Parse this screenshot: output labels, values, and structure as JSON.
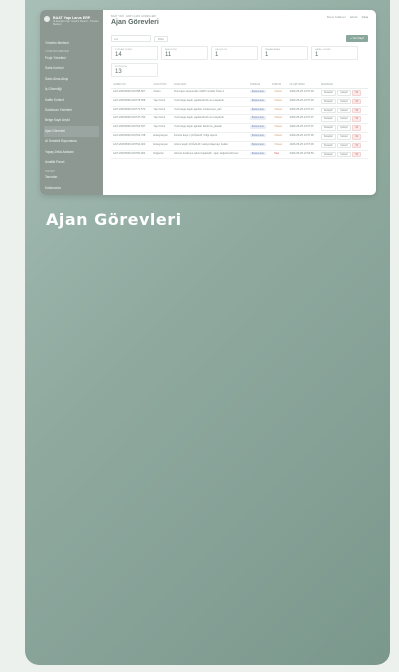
{
  "sidebar": {
    "brand_title": "BAAT Yapı Larus ERP",
    "brand_subtitle": "AI Destekli Yapı Yönetim Sistemi · Yönetim Merkezi",
    "items": [
      {
        "label": "Yönetim Merkezi",
        "type": "item"
      },
      {
        "label": "Yönetim Merkezi",
        "type": "section"
      },
      {
        "label": "Proje Yönetimi",
        "type": "item"
      },
      {
        "label": "Saha Kontrol",
        "type": "item"
      },
      {
        "label": "Satın Alma Akışı",
        "type": "item"
      },
      {
        "label": "İş Güvenliği",
        "type": "item"
      },
      {
        "label": "Kalite Kontrol",
        "type": "item"
      },
      {
        "label": "Doküman Yönetimi",
        "type": "item"
      },
      {
        "label": "Belge Kayıt Arşivi",
        "type": "item"
      },
      {
        "label": "Ajan Görevleri",
        "type": "item",
        "active": true
      },
      {
        "label": "AI Destekli Raporlama",
        "type": "item"
      },
      {
        "label": "Yapay Zekâ Asistanı",
        "type": "item"
      },
      {
        "label": "Analitik Panel",
        "type": "item"
      },
      {
        "label": "Sistem",
        "type": "section"
      },
      {
        "label": "Tanımlar",
        "type": "item"
      },
      {
        "label": "Kullanıcılar",
        "type": "item"
      },
      {
        "label": "Entegrasyonlar",
        "type": "item"
      },
      {
        "label": "Yardım",
        "type": "section"
      },
      {
        "label": "Hakkında",
        "type": "item"
      }
    ]
  },
  "header": {
    "breadcrumb": "BAAT YAPI · ERP / AJAN GÖREVLERİ",
    "title": "Ajan Görevleri",
    "user": "Demo Kullanıcı",
    "user_role": "Admin",
    "logout": "Çıkış"
  },
  "toolbar": {
    "filter_placeholder": "Ara",
    "filter_button": "Filtre",
    "new_button": "+ Yeni Kayıt"
  },
  "stats": [
    {
      "label": "TOPLAM GÖREV",
      "value": "14"
    },
    {
      "label": "BEKLEYEN",
      "value": "11"
    },
    {
      "label": "ÇALIŞIYOR",
      "value": "1"
    },
    {
      "label": "TAMAMLANAN",
      "value": "1"
    },
    {
      "label": "HATALI GÖREV",
      "value": "1"
    },
    {
      "label": "KUYRUKTA",
      "value": "13"
    }
  ],
  "table": {
    "columns": [
      "GÖREV NO",
      "AJAN TÜRÜ",
      "AÇIKLAMA",
      "ÖNCELİK",
      "DURUM",
      "OLUŞTURMA",
      "İŞLEMLER"
    ],
    "rows": [
      {
        "id": "AGT-20260525-015788-567",
        "type": "Ortam",
        "desc": "Test kayıt oluşturuldu / ERP modülü Özeti-1",
        "priority": "Beklemede",
        "priority_color": "blue",
        "status": "Yüksek",
        "status_color": "orange",
        "date": "2026-05-25 13:57:00"
      },
      {
        "id": "AGT-20260525-015778-558",
        "type": "Yapı Kontr",
        "desc": "Yeni belge kaydı yapılandırıldı ve onaylandı",
        "priority": "Beklemede",
        "priority_color": "blue",
        "status": "Yüksek",
        "status_color": "orange",
        "date": "2026-05-25 13:57:00"
      },
      {
        "id": "AGT-20260525-015773-573",
        "type": "Yapı Kontr",
        "desc": "Yeni belge kaydı ajanları incelemeye_alın",
        "priority": "Beklemede",
        "priority_color": "blue",
        "status": "Yüksek",
        "status_color": "orange",
        "date": "2026-05-25 13:57:13"
      },
      {
        "id": "AGT-20260525-015770-793",
        "type": "Yapı Kontr",
        "desc": "Yeni belge kaydı yapılandırıldı ve onaylandı",
        "priority": "Beklemede",
        "priority_color": "blue",
        "status": "Yüksek",
        "status_color": "orange",
        "date": "2026-05-25 13:57:07"
      },
      {
        "id": "AGT-20260525-015764-537",
        "type": "Yapı Kontr",
        "desc": "Yeni belge kaydı ajanları ilerletme_planlar",
        "priority": "Beklemede",
        "priority_color": "blue",
        "status": "Yüksek",
        "status_color": "orange",
        "date": "2026-05-25 13:57:07"
      },
      {
        "id": "AGT-20260525-015762-738",
        "type": "Entegrasyon",
        "desc": "Kontrol kayıt / ÇOĞALDI / bilgi raporu",
        "priority": "Beklemede",
        "priority_color": "blue",
        "status": "Yüksek",
        "status_color": "orange",
        "date": "2026-05-25 13:57:06"
      },
      {
        "id": "AGT-20260525-015762-023",
        "type": "Entegrasyon",
        "desc": "Görev kaydı ÇOĞALDI / aksiyonlaşmayı bekler",
        "priority": "Beklemede",
        "priority_color": "blue",
        "status": "Yüksek",
        "status_color": "orange",
        "date": "2026-05-25 13:57:06"
      },
      {
        "id": "AGT-20260525-015760-964",
        "type": "Değerlen",
        "desc": "Hizmet özetleme işlemi başlatıldı - Ajan değerlendirmesi",
        "priority": "Beklemede",
        "priority_color": "blue",
        "status": "Hata",
        "status_color": "red",
        "date": "2026-05-25 13:56:56"
      }
    ],
    "actions": [
      "Detaylar",
      "Çalıştır",
      "Sil"
    ]
  },
  "caption": "Ajan Görevleri",
  "colors": {
    "accent": "#8aa79c",
    "card_gradient_start": "#a8bfb8",
    "card_gradient_end": "#7b988d",
    "sidebar": "#8d9893"
  }
}
